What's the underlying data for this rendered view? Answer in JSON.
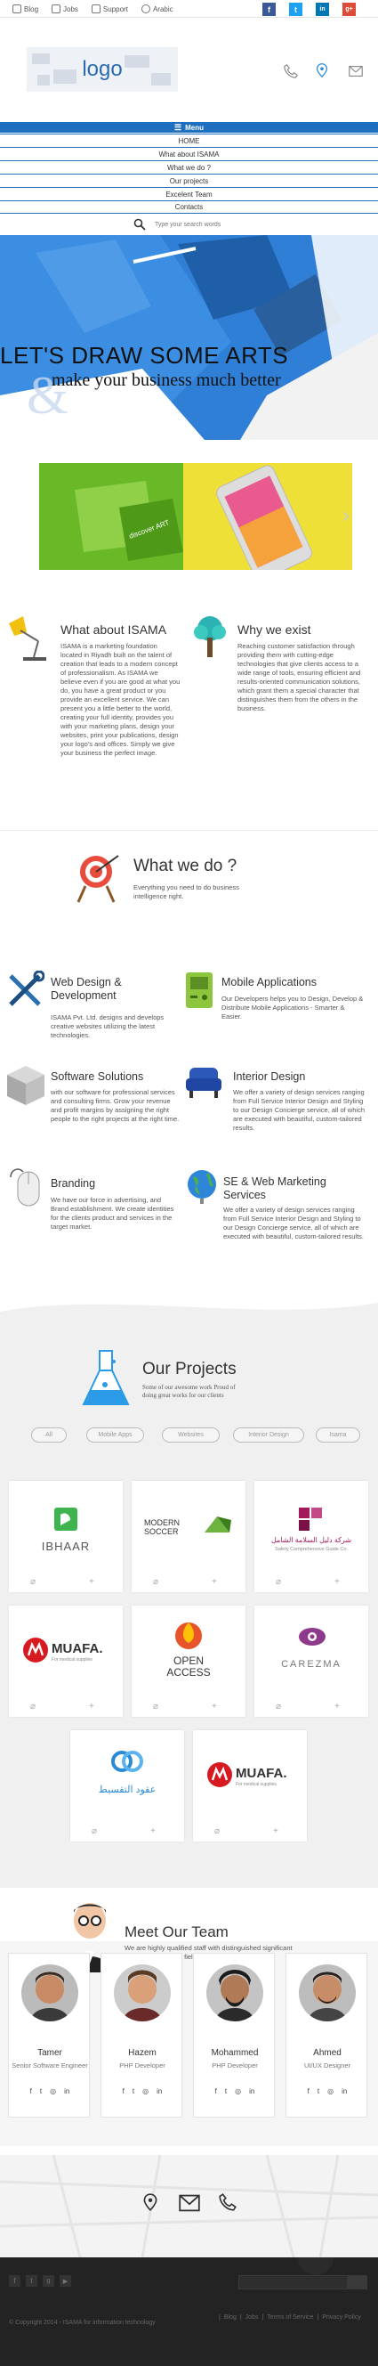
{
  "topbar": {
    "links": [
      {
        "label": "Blog",
        "icon": "blog-icon"
      },
      {
        "label": "Jobs",
        "icon": "briefcase-icon"
      },
      {
        "label": "Support",
        "icon": "support-icon"
      },
      {
        "label": "Arabic",
        "icon": "globe-icon"
      }
    ],
    "social": [
      {
        "icon": "facebook-icon",
        "glyph": "f",
        "color": "#3b5998"
      },
      {
        "icon": "twitter-icon",
        "glyph": "t",
        "color": "#1da1f2"
      },
      {
        "icon": "linkedin-icon",
        "glyph": "in",
        "color": "#0077b5"
      },
      {
        "icon": "google-plus-icon",
        "glyph": "g+",
        "color": "#dd4b39"
      }
    ]
  },
  "header": {
    "logo_text": "logo",
    "icons": [
      "phone-icon",
      "location-icon",
      "mail-icon"
    ]
  },
  "nav": {
    "menu_label": "Menu",
    "items": [
      "HOME",
      "What about ISAMA",
      "What we do ?",
      "Our projects",
      "Excelent Team",
      "Contacts"
    ],
    "search_placeholder": "Type your search words"
  },
  "hero": {
    "headline": "LET'S DRAW SOME ARTS",
    "tagline": "make your business much better"
  },
  "slider": {
    "slide_text": "discover ART",
    "next_icon": "chevron-right-icon"
  },
  "about": {
    "title": "What about ISAMA",
    "text": "ISAMA is a marketing foundation located in Riyadh built on the talent of creation that leads to a modern concept of professionalism. As ISAMA we believe even if you are good at what you do, you have a great product or you provide an excellent service. We can present you a little better to the world, creating your full identity, provides you with your marketing plans, design your websites, print your publications, design your logo's and offices. Simply we give your business the perfect image."
  },
  "why": {
    "title": "Why we exist",
    "text": "Reaching customer satisfaction through providing them with cutting-edge technologies that give clients access to a wide range of tools, ensuring efficient and results-oriented communication solutions, which grant them a special character that distinguishes them from the others in the business."
  },
  "what_we_do": {
    "title": "What we do ?",
    "subtitle": "Everything you need to do business intelligence right."
  },
  "services": [
    {
      "title": "Web Design & Development",
      "text": "ISAMA Pvt. Ltd. designs and develops creative websites utilizing the latest technologies.",
      "icon": "tools-icon"
    },
    {
      "title": "Mobile Applications",
      "text": "Our Developers helps you to Design, Develop & Distribute Mobile Applications - Smarter & Easier.",
      "icon": "gameboy-icon"
    },
    {
      "title": "Software Solutions",
      "text": "with our software for professional services and consulting firms. Grow your revenue and profit margins by assigning the right people to the right projects at the right time.",
      "icon": "cube-icon"
    },
    {
      "title": "Interior Design",
      "text": "We offer a variety of design services ranging from Full Service Interior Design and Styling to our Design Concierge service, all of which are executed with beautiful, custom-tailored results.",
      "icon": "armchair-icon"
    },
    {
      "title": "Branding",
      "text": "We have our force in advertising, and Brand establishment. We create identities for the clients product and services in the target market.",
      "icon": "mouse-icon"
    },
    {
      "title": "SE & Web Marketing Services",
      "text": "We offer a variety of design services ranging from Full Service Interior Design and Styling to our Design Concierge service, all of which are executed with beautiful, custom-tailored results.",
      "icon": "globe-icon"
    }
  ],
  "projects": {
    "title": "Our Projects",
    "subtitle": "Some of our awesome work Proud of doing great works for our clients",
    "filters": [
      "All",
      "Mobile Apps",
      "Websites",
      "Interior Design",
      "Isama"
    ],
    "items": [
      {
        "name": "IBHAAR",
        "color": "#3fb34f"
      },
      {
        "name": "MODERN SOCCER",
        "color": "#6cb33f"
      },
      {
        "name": "شركة دليل السلامة الشامل",
        "sub": "Safety Comprehensive Guide Co.",
        "color": "#a3195b"
      },
      {
        "name": "MUAFA.",
        "sub": "For medical supplies",
        "color": "#d71920"
      },
      {
        "name": "OPEN ACCESS",
        "color": "#e8542a"
      },
      {
        "name": "CAREZMA",
        "color": "#8e3a8c"
      },
      {
        "name": "عقود التقسيط",
        "color": "#2b8ad6"
      },
      {
        "name": "MUAFA.",
        "sub": "For medical supplies",
        "color": "#d71920"
      }
    ]
  },
  "team": {
    "title": "Meet Our Team",
    "subtitle": "We are highly qualified staff with distinguished significant experiences in their field who work under pressure.",
    "members": [
      {
        "name": "Tamer",
        "role": "Senior Software Engineer"
      },
      {
        "name": "Hazem",
        "role": "PHP Developer"
      },
      {
        "name": "Mohammed",
        "role": "PHP Developer"
      },
      {
        "name": "Ahmed",
        "role": "UI/UX Designer"
      }
    ],
    "social": [
      "f",
      "t",
      "in",
      "in"
    ]
  },
  "contact": {
    "icons": [
      "location-icon",
      "mail-icon",
      "phone-icon"
    ]
  },
  "footer": {
    "social": [
      "facebook-icon",
      "twitter-icon",
      "google-plus-icon",
      "youtube-icon"
    ],
    "newsletter_placeholder": "",
    "copyright": "© Copyright 2014 - ISAMA for information technology",
    "links": [
      "Blog",
      "Jobs",
      "Terms of Service",
      "Privacy Policy"
    ]
  },
  "colors": {
    "brand_blue": "#1f6fc0",
    "footer": "#232323"
  }
}
